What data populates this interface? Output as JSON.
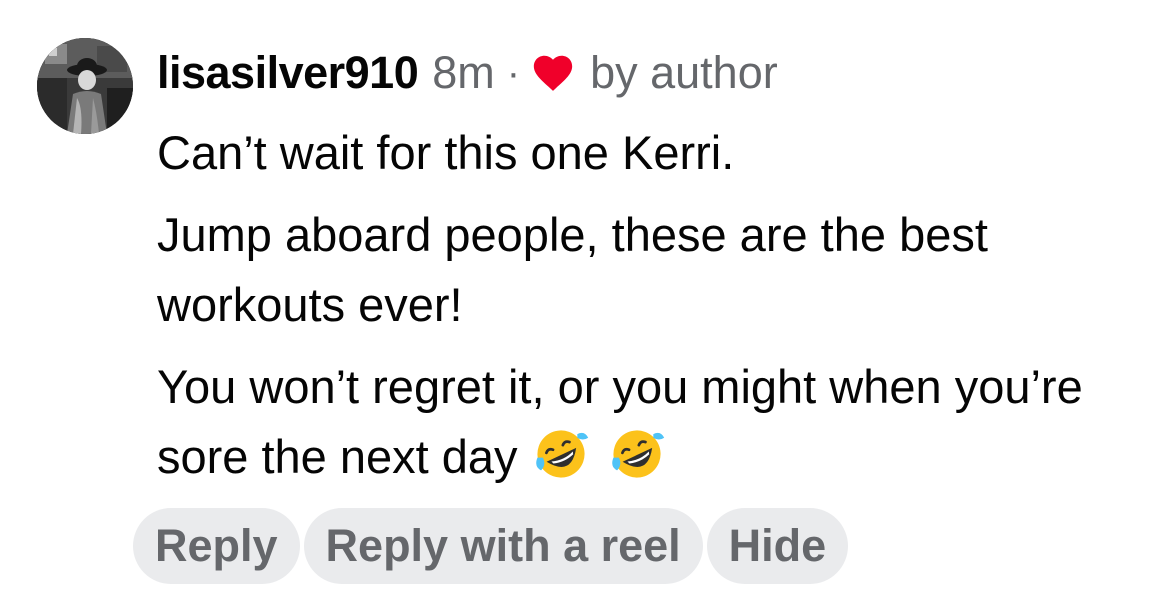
{
  "comment": {
    "username": "lisasilver910",
    "time": "8m",
    "separator": "·",
    "author_reaction_label": "by author",
    "author_reaction_icon": "heart-icon",
    "heart_color": "#f0002a",
    "paragraphs": [
      "Can’t wait for this one Kerri.",
      "Jump aboard people, these are the best workouts ever!",
      "You won’t regret it, or you might when you’re sore the next day"
    ],
    "trailing_emojis": [
      "rolling-on-floor-laughing-emoji",
      "rolling-on-floor-laughing-emoji"
    ]
  },
  "actions": {
    "reply_label": "Reply",
    "reply_reel_label": "Reply with a reel",
    "hide_label": "Hide"
  },
  "colors": {
    "text_primary": "#050505",
    "text_secondary": "#65676b",
    "pill_background": "#eaebed"
  }
}
